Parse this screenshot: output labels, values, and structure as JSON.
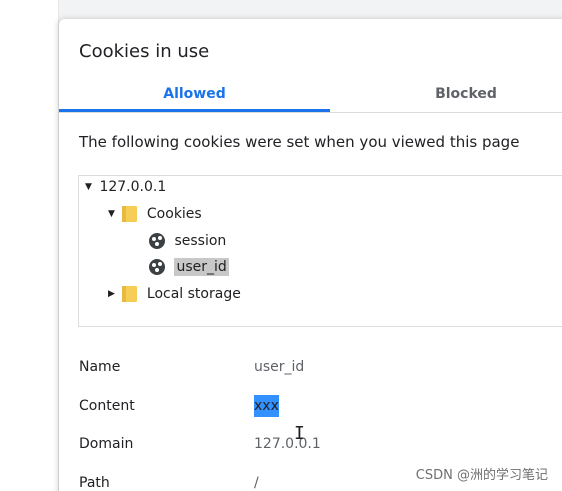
{
  "dialog": {
    "title": "Cookies in use",
    "tabs": [
      {
        "label": "Allowed",
        "active": true
      },
      {
        "label": "Blocked",
        "active": false
      }
    ],
    "description": "The following cookies were set when you viewed this page",
    "tree": {
      "host": "127.0.0.1",
      "cookies_folder": "Cookies",
      "cookies": [
        "session",
        "user_id"
      ],
      "selected": "user_id",
      "local_storage": "Local storage"
    },
    "details": [
      {
        "key": "Name",
        "value": "user_id"
      },
      {
        "key": "Content",
        "value": "xxx"
      },
      {
        "key": "Domain",
        "value": "127.0.0.1"
      },
      {
        "key": "Path",
        "value": "/"
      }
    ]
  },
  "watermark": "CSDN @洲的学习笔记",
  "colors": {
    "accent": "#1a73e8",
    "folder": "#f5cd57",
    "selection": "#3390ff"
  }
}
